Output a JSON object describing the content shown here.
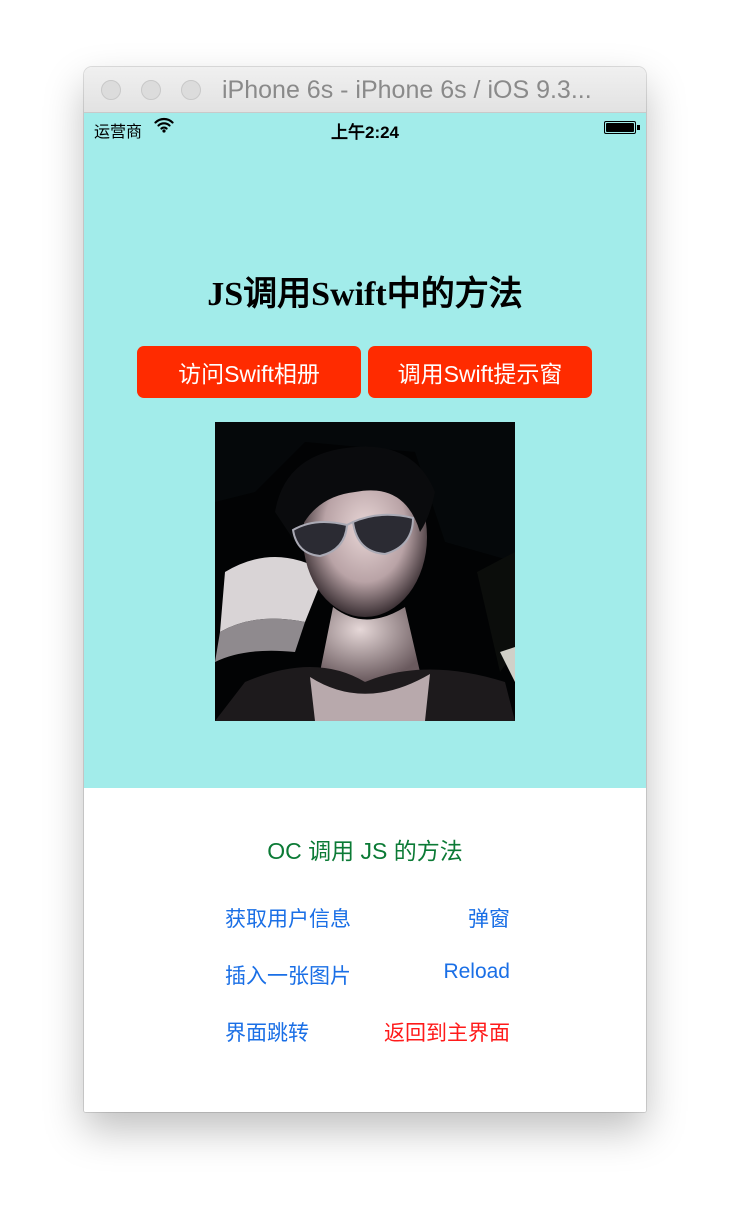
{
  "window": {
    "title": "iPhone 6s - iPhone 6s / iOS 9.3..."
  },
  "statusbar": {
    "carrier": "运营商",
    "time": "上午2:24"
  },
  "web": {
    "heading": "JS调用Swift中的方法",
    "buttons": [
      "访问Swift相册",
      "调用Swift提示窗"
    ]
  },
  "native": {
    "title": "OC 调用 JS 的方法",
    "actions": [
      {
        "label": "获取用户信息"
      },
      {
        "label": "弹窗"
      },
      {
        "label": "插入一张图片"
      },
      {
        "label": "Reload"
      },
      {
        "label": "界面跳转"
      },
      {
        "label": "返回到主界面",
        "color": "#ff1a1a"
      }
    ]
  },
  "colors": {
    "web_background": "#a2ecea",
    "button_red": "#ff2b00",
    "link_blue": "#1a6fe6",
    "title_green": "#0b7a35"
  }
}
